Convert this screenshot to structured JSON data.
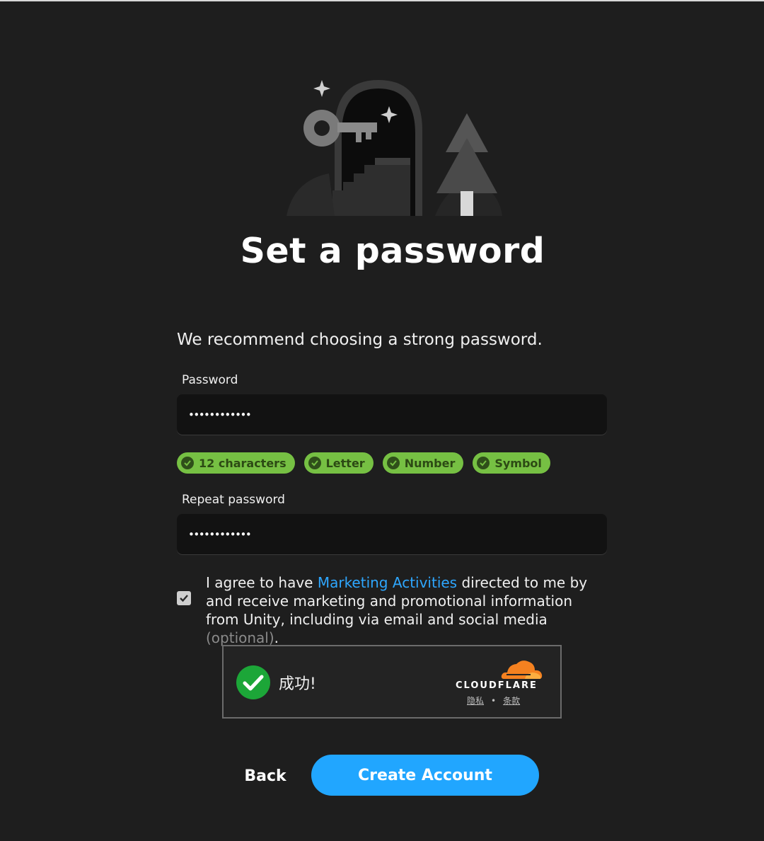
{
  "header": {
    "title": "Set a password",
    "subtitle": "We recommend choosing a strong password."
  },
  "password_field": {
    "label": "Password",
    "value": "••••••••••••"
  },
  "requirements": [
    {
      "label": "12 characters",
      "met": true
    },
    {
      "label": "Letter",
      "met": true
    },
    {
      "label": "Number",
      "met": true
    },
    {
      "label": "Symbol",
      "met": true
    }
  ],
  "repeat_field": {
    "label": "Repeat password",
    "value": "••••••••••••"
  },
  "consent": {
    "checked": true,
    "text_before": "I agree to have ",
    "link_text": "Marketing Activities",
    "text_after": " directed to me by and receive marketing and promotional information from Unity, including via email and social media ",
    "optional_text": "(optional)",
    "end": "."
  },
  "captcha": {
    "status_text": "成功!",
    "brand": "CLOUDFLARE",
    "privacy_link": "隐私",
    "separator": "•",
    "terms_link": "条款"
  },
  "actions": {
    "back_label": "Back",
    "create_label": "Create Account"
  },
  "colors": {
    "background": "#1e1e1e",
    "accent": "#21a6ff",
    "chip_green": "#76c043",
    "cloudflare_orange": "#f48120",
    "success_green": "#1ca638"
  }
}
